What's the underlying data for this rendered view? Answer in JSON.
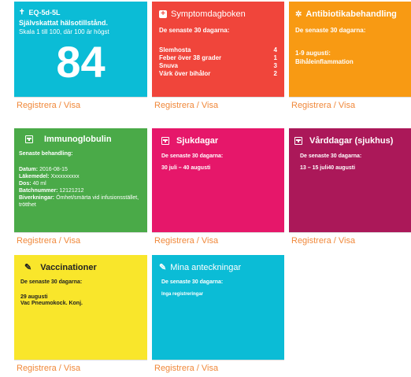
{
  "eq": {
    "title": "EQ-5d-5L",
    "subtitle": "Självskattat hälsotillstånd.",
    "scale": "Skala 1 till 100, där 100 är högst",
    "value": "84",
    "footer": "Registrera / Visa",
    "color": "#0bbcd6"
  },
  "symptom": {
    "title": "Symptomdagboken",
    "period": "De senaste 30 dagarna:",
    "rows": [
      {
        "label": "Slemhosta",
        "count": "4"
      },
      {
        "label": "Feber över 38 grader",
        "count": "1"
      },
      {
        "label": "Snuva",
        "count": "3"
      },
      {
        "label": "Värk över bihålor",
        "count": "2"
      }
    ],
    "footer": "Registrera / Visa",
    "color": "#f0453b"
  },
  "antibiotika": {
    "title": "Antibiotikabehandling",
    "period": "De senaste 30 dagarna:",
    "line1": "1-9 augusti:",
    "line2": "Bihåleinflammation",
    "footer": "Registrera / Visa",
    "color": "#f89a13"
  },
  "immuno": {
    "title": "Immunoglobulin",
    "period": "Senaste behandling:",
    "fields": [
      {
        "label": "Datum:",
        "value": "2016-08-15"
      },
      {
        "label": "Läkemedel:",
        "value": "Xxxxxxxxxx"
      },
      {
        "label": "Dos:",
        "value": "40 ml"
      },
      {
        "label": "Batchnummer:",
        "value": "12121212"
      },
      {
        "label": "Biverkningar:",
        "value": "Ömhet/smärta vid infusionsstället, trötthet"
      }
    ],
    "footer": "Registrera / Visa",
    "color": "#4aaa48"
  },
  "sjuk": {
    "title": "Sjukdagar",
    "period": "De senaste 30 dagarna:",
    "line1": "30 juli – 40 augusti",
    "footer": "Registrera / Visa",
    "color": "#e6176a"
  },
  "vard": {
    "title": "Vårddagar (sjukhus)",
    "period": "De senaste 30 dagarna:",
    "line1": "13 – 15 juli40 augusti",
    "footer": "Registrera / Visa",
    "color": "#ab1859"
  },
  "vacc": {
    "title": "Vaccinationer",
    "period": "De senaste 30 dagarna:",
    "line1": "29 augusti",
    "line2": "Vac Pneumokock. Konj.",
    "footer": "Registrera / Visa",
    "color": "#f9e62b"
  },
  "notes": {
    "title": "Mina anteckningar",
    "period": "De senaste 30 dagarna:",
    "line1": "Inga registreringar",
    "footer": "Registrera / Visa",
    "color": "#0bbcd6"
  }
}
